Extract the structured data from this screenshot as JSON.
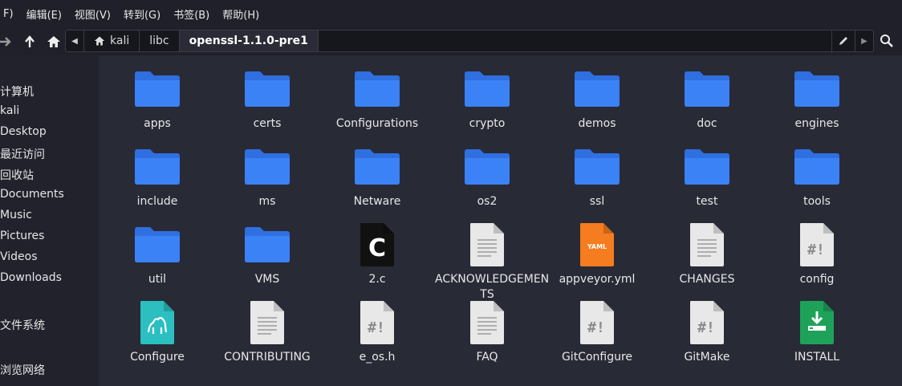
{
  "menubar": {
    "items": [
      {
        "label": "F)"
      },
      {
        "label": "编辑(E)"
      },
      {
        "label": "视图(V)"
      },
      {
        "label": "转到(G)"
      },
      {
        "label": "书签(B)"
      },
      {
        "label": "帮助(H)"
      }
    ]
  },
  "path": {
    "crumbs": [
      {
        "label": "kali"
      },
      {
        "label": "libc"
      },
      {
        "label": "openssl-1.1.0-pre1"
      }
    ]
  },
  "sidebar": {
    "items": [
      {
        "label": "计算机"
      },
      {
        "label": "kali"
      },
      {
        "label": "Desktop"
      },
      {
        "label": "最近访问"
      },
      {
        "label": "回收站"
      },
      {
        "label": "Documents"
      },
      {
        "label": "Music"
      },
      {
        "label": "Pictures"
      },
      {
        "label": "Videos"
      },
      {
        "label": "Downloads"
      },
      {
        "label": "文件系统"
      },
      {
        "label": "浏览网络"
      }
    ]
  },
  "files": [
    {
      "name": "apps",
      "icon": "folder-icon"
    },
    {
      "name": "certs",
      "icon": "folder-icon"
    },
    {
      "name": "Configurations",
      "icon": "folder-icon"
    },
    {
      "name": "crypto",
      "icon": "folder-icon"
    },
    {
      "name": "demos",
      "icon": "folder-icon"
    },
    {
      "name": "doc",
      "icon": "folder-icon"
    },
    {
      "name": "engines",
      "icon": "folder-icon"
    },
    {
      "name": "include",
      "icon": "folder-icon"
    },
    {
      "name": "ms",
      "icon": "folder-icon"
    },
    {
      "name": "Netware",
      "icon": "folder-icon"
    },
    {
      "name": "os2",
      "icon": "folder-icon"
    },
    {
      "name": "ssl",
      "icon": "folder-icon"
    },
    {
      "name": "test",
      "icon": "folder-icon"
    },
    {
      "name": "tools",
      "icon": "folder-icon"
    },
    {
      "name": "util",
      "icon": "folder-icon"
    },
    {
      "name": "VMS",
      "icon": "folder-icon"
    },
    {
      "name": "2.c",
      "icon": "c-source-file-icon",
      "glyph": "C"
    },
    {
      "name": "ACKNOWLEDGEMENTS",
      "icon": "text-file-icon"
    },
    {
      "name": "appveyor.yml",
      "icon": "yaml-file-icon",
      "glyph": "YAML"
    },
    {
      "name": "CHANGES",
      "icon": "text-file-icon"
    },
    {
      "name": "config",
      "icon": "script-file-icon",
      "glyph": "#!"
    },
    {
      "name": "Configure",
      "icon": "perl-script-icon"
    },
    {
      "name": "CONTRIBUTING",
      "icon": "text-file-icon"
    },
    {
      "name": "e_os.h",
      "icon": "script-file-icon",
      "glyph": "#!"
    },
    {
      "name": "FAQ",
      "icon": "text-file-icon"
    },
    {
      "name": "GitConfigure",
      "icon": "script-file-icon",
      "glyph": "#!"
    },
    {
      "name": "GitMake",
      "icon": "script-file-icon",
      "glyph": "#!"
    },
    {
      "name": "INSTALL",
      "icon": "install-package-icon"
    }
  ],
  "colors": {
    "folder": "#3b82f6",
    "folder_tab": "#2f6fe0",
    "text_file": "#e8e8e8",
    "yaml": "#f57c1f",
    "perl": "#2bbfc0",
    "install": "#1ea25a",
    "c_file": "#111111"
  }
}
